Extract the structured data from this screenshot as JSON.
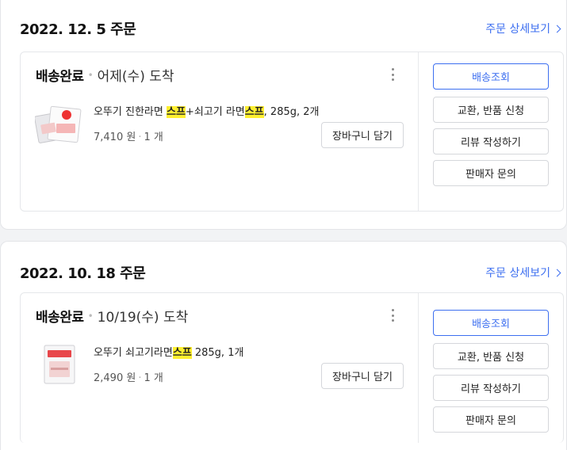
{
  "orders": [
    {
      "date": "2022. 12. 5 주문",
      "detail_link": "주문 상세보기",
      "status": "배송완료",
      "arrival": "어제(수) 도착",
      "product": {
        "name_pre": "오뚜기 진한라면 ",
        "name_hl1": "스프",
        "name_mid": "+쇠고기 라면",
        "name_hl2": "스프",
        "name_post": ", 285g, 2개",
        "price": "7,410 원",
        "qty": "1 개",
        "thumbnail_icon": "soup-packet-image"
      },
      "cart_button": "장바구니 담기",
      "actions": [
        "배송조회",
        "교환, 반품 신청",
        "리뷰 작성하기",
        "판매자 문의"
      ]
    },
    {
      "date": "2022. 10. 18 주문",
      "detail_link": "주문 상세보기",
      "status": "배송완료",
      "arrival": "10/19(수) 도착",
      "product": {
        "name_pre": "오뚜기 쇠고기라면",
        "name_hl1": "스프",
        "name_post": " 285g, 1개",
        "price": "2,490 원",
        "qty": "1 개",
        "thumbnail_icon": "soup-packet-image"
      },
      "cart_button": "장바구니 담기",
      "actions": [
        "배송조회",
        "교환, 반품 신청",
        "리뷰 작성하기",
        "판매자 문의"
      ]
    }
  ],
  "colors": {
    "accent": "#3d6ff0",
    "highlight": "#ffef2f",
    "background": "#f2f3f5"
  }
}
